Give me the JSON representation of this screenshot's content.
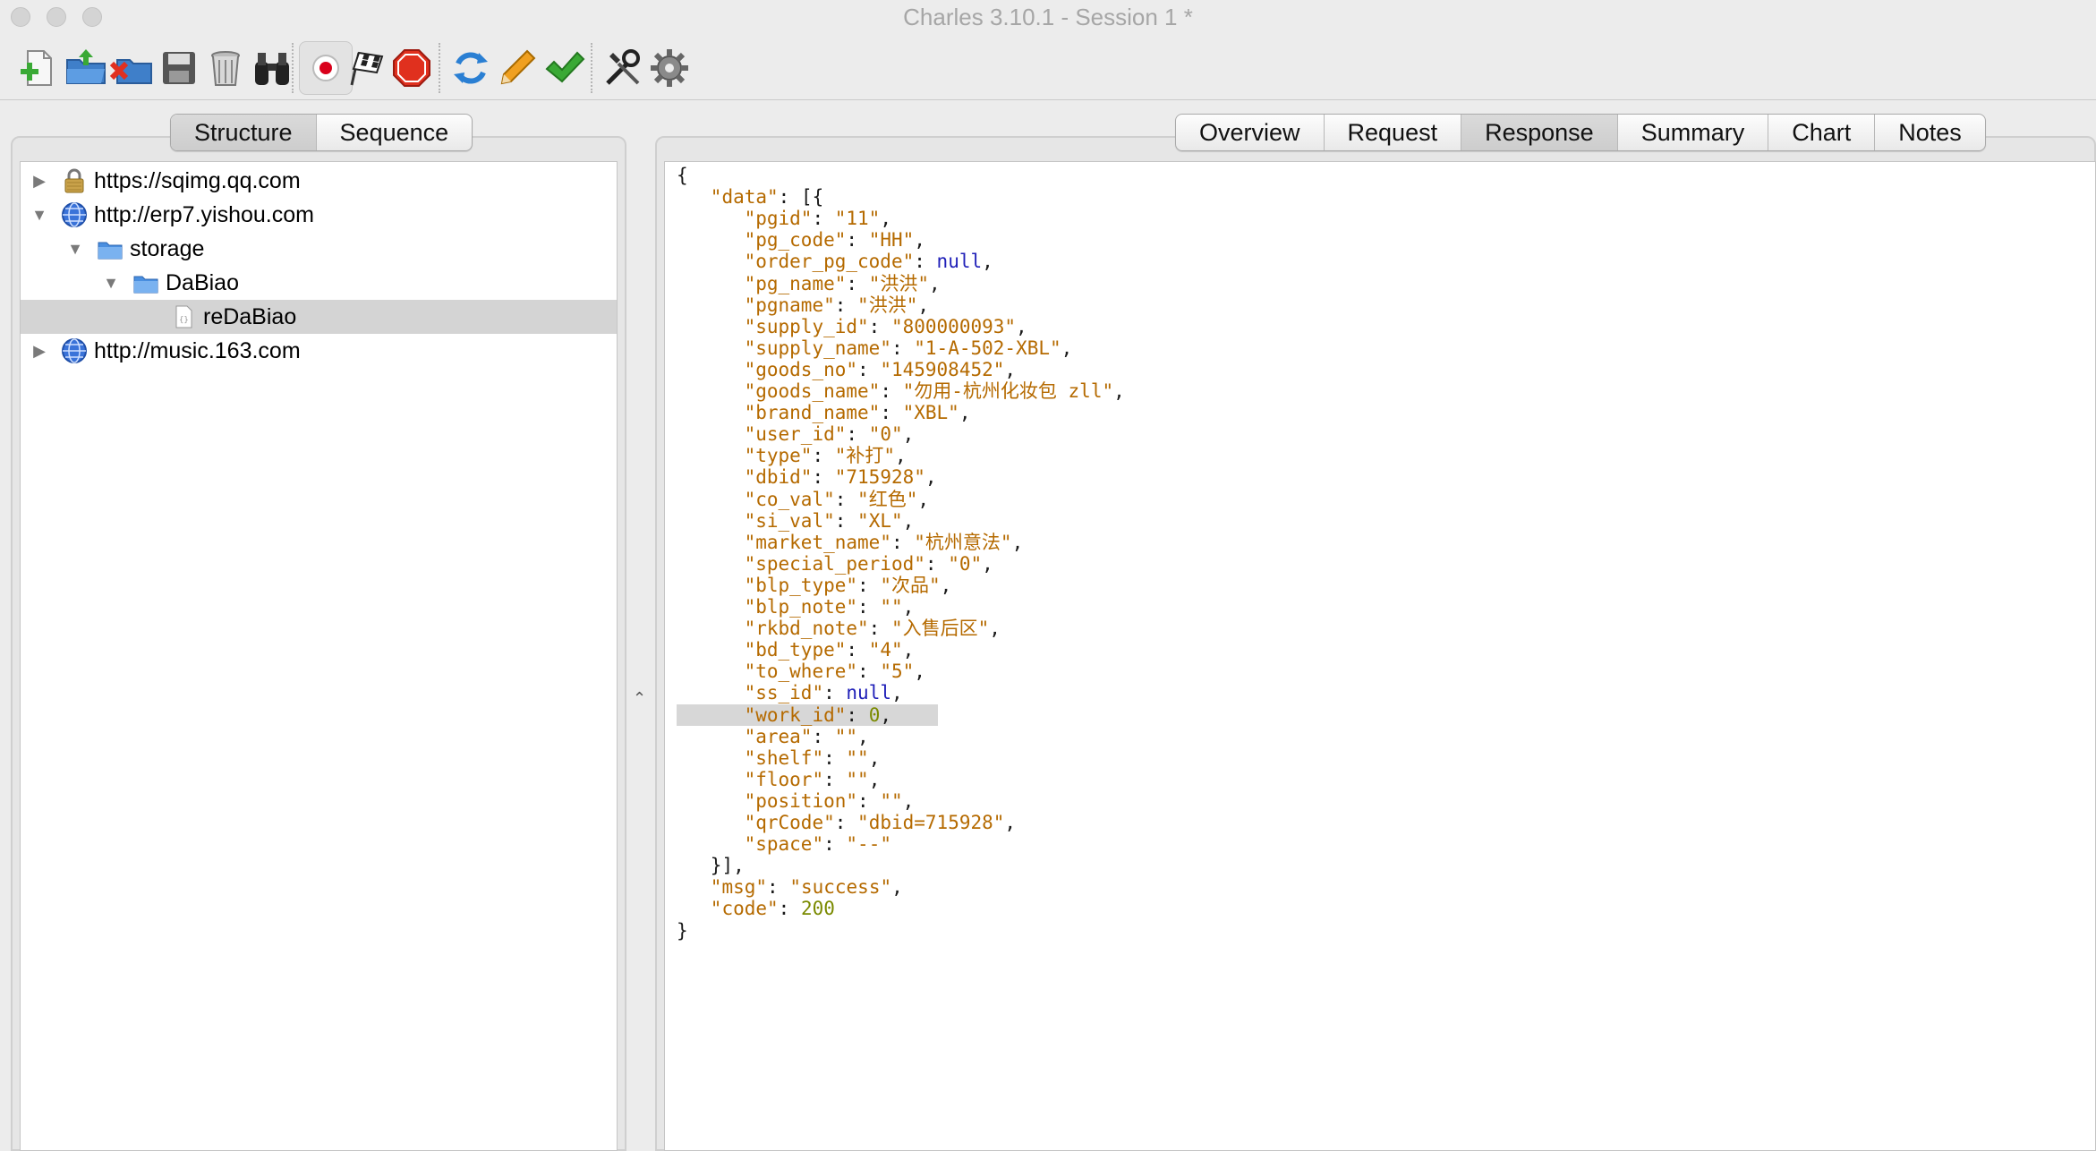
{
  "window": {
    "title": "Charles 3.10.1 - Session 1 *"
  },
  "toolbar": {
    "buttons": [
      {
        "name": "new-session",
        "icon": "new-document-plus-icon"
      },
      {
        "name": "open-session",
        "icon": "open-folder-icon"
      },
      {
        "name": "close-session",
        "icon": "close-folder-x-icon"
      },
      {
        "name": "save-session",
        "icon": "floppy-disk-icon"
      },
      {
        "name": "clear-session",
        "icon": "trash-can-icon"
      },
      {
        "name": "find",
        "icon": "binoculars-icon"
      },
      {
        "name": "start-recording",
        "icon": "record-icon"
      },
      {
        "name": "throttling",
        "icon": "checkered-flag-icon"
      },
      {
        "name": "breakpoints",
        "icon": "stop-sign-icon"
      },
      {
        "name": "repeat",
        "icon": "refresh-icon"
      },
      {
        "name": "edit",
        "icon": "pencil-icon"
      },
      {
        "name": "validate",
        "icon": "checkmark-icon"
      },
      {
        "name": "tools",
        "icon": "wrench-screwdriver-icon"
      },
      {
        "name": "settings",
        "icon": "gear-icon"
      }
    ]
  },
  "left_tabs": [
    "Structure",
    "Sequence"
  ],
  "right_tabs": [
    "Overview",
    "Request",
    "Response",
    "Summary",
    "Chart",
    "Notes"
  ],
  "selected_right_tab": "Response",
  "tree": [
    {
      "label": "https://sqimg.qq.com",
      "icon": "lock-icon",
      "expanded": false
    },
    {
      "label": "http://erp7.yishou.com",
      "icon": "globe-icon",
      "expanded": true
    },
    {
      "label": "storage",
      "icon": "folder-icon",
      "expanded": true
    },
    {
      "label": "DaBiao",
      "icon": "folder-icon",
      "expanded": true
    },
    {
      "label": "reDaBiao",
      "icon": "json-file-icon",
      "selected": true
    },
    {
      "label": "http://music.163.com",
      "icon": "globe-icon",
      "expanded": false
    }
  ],
  "response_json": {
    "data_fields": [
      {
        "key": "pgid",
        "value": "\"11\"",
        "type": "string"
      },
      {
        "key": "pg_code",
        "value": "\"HH\"",
        "type": "string"
      },
      {
        "key": "order_pg_code",
        "value": "null",
        "type": "null"
      },
      {
        "key": "pg_name",
        "value": "\"洪洪\"",
        "type": "string"
      },
      {
        "key": "pgname",
        "value": "\"洪洪\"",
        "type": "string"
      },
      {
        "key": "supply_id",
        "value": "\"800000093\"",
        "type": "string"
      },
      {
        "key": "supply_name",
        "value": "\"1-A-502-XBL\"",
        "type": "string"
      },
      {
        "key": "goods_no",
        "value": "\"145908452\"",
        "type": "string"
      },
      {
        "key": "goods_name",
        "value": "\"勿用-杭州化妆包 zll\"",
        "type": "string"
      },
      {
        "key": "brand_name",
        "value": "\"XBL\"",
        "type": "string"
      },
      {
        "key": "user_id",
        "value": "\"0\"",
        "type": "string"
      },
      {
        "key": "type",
        "value": "\"补打\"",
        "type": "string"
      },
      {
        "key": "dbid",
        "value": "\"715928\"",
        "type": "string"
      },
      {
        "key": "co_val",
        "value": "\"红色\"",
        "type": "string"
      },
      {
        "key": "si_val",
        "value": "\"XL\"",
        "type": "string"
      },
      {
        "key": "market_name",
        "value": "\"杭州意法\"",
        "type": "string"
      },
      {
        "key": "special_period",
        "value": "\"0\"",
        "type": "string"
      },
      {
        "key": "blp_type",
        "value": "\"次品\"",
        "type": "string"
      },
      {
        "key": "blp_note",
        "value": "\"\"",
        "type": "string"
      },
      {
        "key": "rkbd_note",
        "value": "\"入售后区\"",
        "type": "string"
      },
      {
        "key": "bd_type",
        "value": "\"4\"",
        "type": "string"
      },
      {
        "key": "to_where",
        "value": "\"5\"",
        "type": "string"
      },
      {
        "key": "ss_id",
        "value": "null",
        "type": "null"
      },
      {
        "key": "work_id",
        "value": "0",
        "type": "number",
        "highlighted": true
      },
      {
        "key": "area",
        "value": "\"\"",
        "type": "string"
      },
      {
        "key": "shelf",
        "value": "\"\"",
        "type": "string"
      },
      {
        "key": "floor",
        "value": "\"\"",
        "type": "string"
      },
      {
        "key": "position",
        "value": "\"\"",
        "type": "string"
      },
      {
        "key": "qrCode",
        "value": "\"dbid=715928\"",
        "type": "string"
      },
      {
        "key": "space",
        "value": "\"--\"",
        "type": "string"
      }
    ],
    "msg": "\"success\"",
    "code": "200"
  }
}
